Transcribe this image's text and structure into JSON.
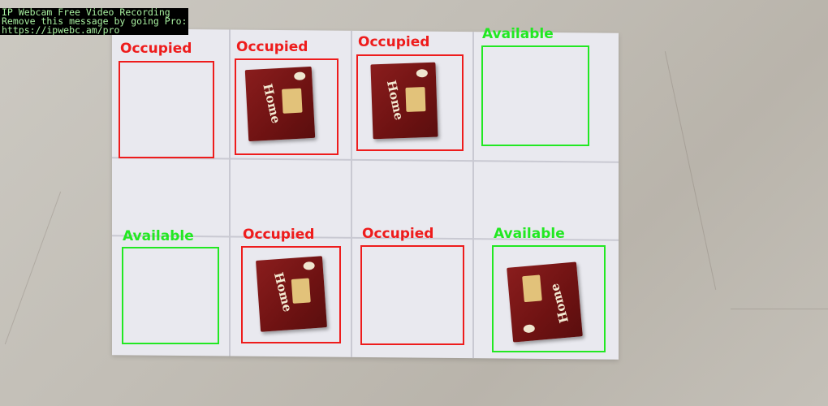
{
  "overlay": {
    "line1": "IP Webcam Free Video Recording",
    "line2": "Remove this message by going Pro:",
    "line3": "https://ipwebc.am/pro"
  },
  "colors": {
    "occupied": "#ee1c1c",
    "available": "#22e822",
    "box": "#7a1616",
    "paper": "#e9e9ef"
  },
  "slots": [
    {
      "id": 1,
      "label": "Occupied",
      "status": "occupied"
    },
    {
      "id": 2,
      "label": "Occupied",
      "status": "occupied"
    },
    {
      "id": 3,
      "label": "Occupied",
      "status": "occupied"
    },
    {
      "id": 4,
      "label": "Available",
      "status": "available"
    },
    {
      "id": 5,
      "label": "Available",
      "status": "available"
    },
    {
      "id": 6,
      "label": "Occupied",
      "status": "occupied"
    },
    {
      "id": 7,
      "label": "Occupied",
      "status": "occupied"
    },
    {
      "id": 8,
      "label": "Available",
      "status": "available"
    }
  ],
  "box_brand": "Home"
}
